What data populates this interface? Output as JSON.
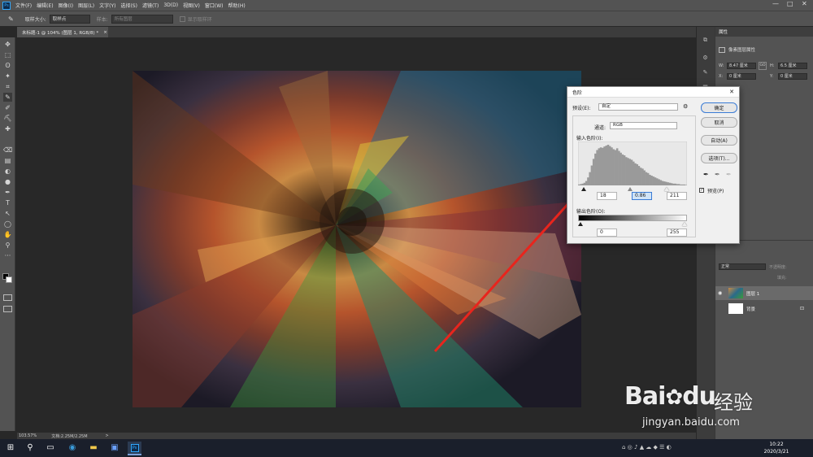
{
  "app": {
    "logo": "Ps"
  },
  "menu": [
    "文件(F)",
    "编辑(E)",
    "图像(I)",
    "图层(L)",
    "文字(Y)",
    "选择(S)",
    "滤镜(T)",
    "3D(D)",
    "视图(V)",
    "窗口(W)",
    "帮助(H)"
  ],
  "window_controls": {
    "minimize": "—",
    "maximize": "□",
    "close": "✕"
  },
  "options": {
    "sample_size_label": "取样大小:",
    "sample_size_value": "取样点",
    "sample_label": "样本:",
    "sample_value": "所有图层",
    "show_ring_label": "显示取样环"
  },
  "document_tab": {
    "title": "未标题-1 @ 104% (图层 1, RGB/8) *",
    "close": "×"
  },
  "tools": [
    "✥",
    "⬚",
    "ʘ",
    "✦",
    "⌗",
    "✎",
    "✐",
    "⛏",
    "✚",
    "⌫",
    "▤",
    "◐",
    "●",
    "✒",
    "T",
    "↖",
    "◯",
    "✋",
    "⚲",
    "···"
  ],
  "status": {
    "zoom": "103.57%",
    "doc": "文档:2.25M/2.25M",
    "arrow": ">"
  },
  "properties": {
    "tab": "属性",
    "header": "像素图层属性",
    "w_label": "W:",
    "w_value": "8.47 厘米",
    "h_label": "H:",
    "h_value": "6.5 厘米",
    "x_label": "X:",
    "x_value": "0 厘米",
    "y_label": "Y:",
    "y_value": "0 厘米",
    "link": "GO"
  },
  "layers": {
    "blend_mode": "正常",
    "opacity_label": "不透明度:",
    "fill_label": "填充:",
    "items": [
      {
        "name": "图层 1",
        "visible": "👁"
      },
      {
        "name": "背景",
        "lock": "🔒"
      }
    ]
  },
  "levels_dialog": {
    "title": "色阶",
    "close": "✕",
    "preset_label": "预设(E):",
    "preset_value": "自定",
    "channel_label": "通道:",
    "channel_value": "RGB",
    "input_label": "输入色阶(I):",
    "input_black": "18",
    "input_gamma": "0.86",
    "input_white": "211",
    "output_label": "输出色阶(O):",
    "output_black": "0",
    "output_white": "255",
    "btn_ok": "确定",
    "btn_cancel": "取消",
    "btn_auto": "自动(A)",
    "btn_options": "选项(T)...",
    "preview_label": "预览(P)",
    "preview_checked": true,
    "histogram": [
      2,
      3,
      4,
      6,
      10,
      18,
      30,
      45,
      60,
      72,
      80,
      84,
      86,
      85,
      88,
      90,
      92,
      89,
      86,
      82,
      80,
      84,
      78,
      74,
      70,
      68,
      64,
      62,
      60,
      58,
      54,
      50,
      48,
      44,
      40,
      38,
      34,
      30,
      28,
      24,
      22,
      20,
      18,
      16,
      14,
      12,
      10,
      9,
      8,
      7,
      6,
      5,
      4,
      4,
      3,
      3,
      2,
      2,
      2,
      1
    ]
  },
  "taskbar": {
    "start": "⊞",
    "time": "10:22",
    "date": "2020/3/21"
  },
  "watermark": {
    "brand": "Bai",
    "brand2": "du",
    "cn": "经验",
    "url": "jingyan.baidu.com"
  }
}
